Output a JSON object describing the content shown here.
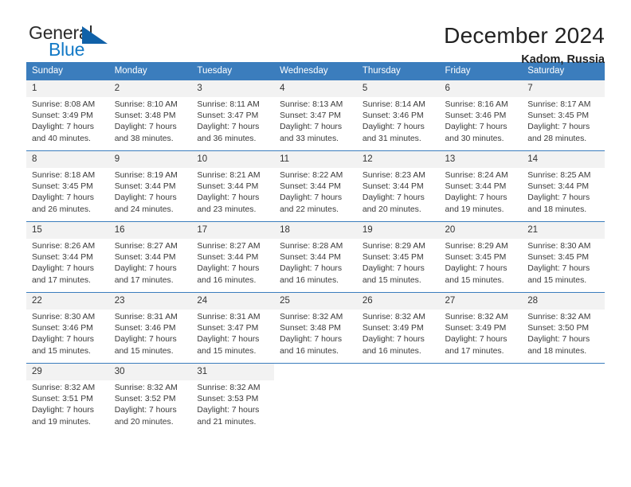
{
  "brand": {
    "name_part1": "General",
    "name_part2": "Blue",
    "logo_icon": "triangle-icon"
  },
  "header": {
    "title": "December 2024",
    "location": "Kadom, Russia"
  },
  "calendar": {
    "weekday_headers": [
      "Sunday",
      "Monday",
      "Tuesday",
      "Wednesday",
      "Thursday",
      "Friday",
      "Saturday"
    ],
    "accent_color": "#3b7dbd",
    "daynum_band_color": "#f2f2f2",
    "weeks": [
      [
        {
          "day": "1",
          "sunrise": "Sunrise: 8:08 AM",
          "sunset": "Sunset: 3:49 PM",
          "daylight_line1": "Daylight: 7 hours",
          "daylight_line2": "and 40 minutes."
        },
        {
          "day": "2",
          "sunrise": "Sunrise: 8:10 AM",
          "sunset": "Sunset: 3:48 PM",
          "daylight_line1": "Daylight: 7 hours",
          "daylight_line2": "and 38 minutes."
        },
        {
          "day": "3",
          "sunrise": "Sunrise: 8:11 AM",
          "sunset": "Sunset: 3:47 PM",
          "daylight_line1": "Daylight: 7 hours",
          "daylight_line2": "and 36 minutes."
        },
        {
          "day": "4",
          "sunrise": "Sunrise: 8:13 AM",
          "sunset": "Sunset: 3:47 PM",
          "daylight_line1": "Daylight: 7 hours",
          "daylight_line2": "and 33 minutes."
        },
        {
          "day": "5",
          "sunrise": "Sunrise: 8:14 AM",
          "sunset": "Sunset: 3:46 PM",
          "daylight_line1": "Daylight: 7 hours",
          "daylight_line2": "and 31 minutes."
        },
        {
          "day": "6",
          "sunrise": "Sunrise: 8:16 AM",
          "sunset": "Sunset: 3:46 PM",
          "daylight_line1": "Daylight: 7 hours",
          "daylight_line2": "and 30 minutes."
        },
        {
          "day": "7",
          "sunrise": "Sunrise: 8:17 AM",
          "sunset": "Sunset: 3:45 PM",
          "daylight_line1": "Daylight: 7 hours",
          "daylight_line2": "and 28 minutes."
        }
      ],
      [
        {
          "day": "8",
          "sunrise": "Sunrise: 8:18 AM",
          "sunset": "Sunset: 3:45 PM",
          "daylight_line1": "Daylight: 7 hours",
          "daylight_line2": "and 26 minutes."
        },
        {
          "day": "9",
          "sunrise": "Sunrise: 8:19 AM",
          "sunset": "Sunset: 3:44 PM",
          "daylight_line1": "Daylight: 7 hours",
          "daylight_line2": "and 24 minutes."
        },
        {
          "day": "10",
          "sunrise": "Sunrise: 8:21 AM",
          "sunset": "Sunset: 3:44 PM",
          "daylight_line1": "Daylight: 7 hours",
          "daylight_line2": "and 23 minutes."
        },
        {
          "day": "11",
          "sunrise": "Sunrise: 8:22 AM",
          "sunset": "Sunset: 3:44 PM",
          "daylight_line1": "Daylight: 7 hours",
          "daylight_line2": "and 22 minutes."
        },
        {
          "day": "12",
          "sunrise": "Sunrise: 8:23 AM",
          "sunset": "Sunset: 3:44 PM",
          "daylight_line1": "Daylight: 7 hours",
          "daylight_line2": "and 20 minutes."
        },
        {
          "day": "13",
          "sunrise": "Sunrise: 8:24 AM",
          "sunset": "Sunset: 3:44 PM",
          "daylight_line1": "Daylight: 7 hours",
          "daylight_line2": "and 19 minutes."
        },
        {
          "day": "14",
          "sunrise": "Sunrise: 8:25 AM",
          "sunset": "Sunset: 3:44 PM",
          "daylight_line1": "Daylight: 7 hours",
          "daylight_line2": "and 18 minutes."
        }
      ],
      [
        {
          "day": "15",
          "sunrise": "Sunrise: 8:26 AM",
          "sunset": "Sunset: 3:44 PM",
          "daylight_line1": "Daylight: 7 hours",
          "daylight_line2": "and 17 minutes."
        },
        {
          "day": "16",
          "sunrise": "Sunrise: 8:27 AM",
          "sunset": "Sunset: 3:44 PM",
          "daylight_line1": "Daylight: 7 hours",
          "daylight_line2": "and 17 minutes."
        },
        {
          "day": "17",
          "sunrise": "Sunrise: 8:27 AM",
          "sunset": "Sunset: 3:44 PM",
          "daylight_line1": "Daylight: 7 hours",
          "daylight_line2": "and 16 minutes."
        },
        {
          "day": "18",
          "sunrise": "Sunrise: 8:28 AM",
          "sunset": "Sunset: 3:44 PM",
          "daylight_line1": "Daylight: 7 hours",
          "daylight_line2": "and 16 minutes."
        },
        {
          "day": "19",
          "sunrise": "Sunrise: 8:29 AM",
          "sunset": "Sunset: 3:45 PM",
          "daylight_line1": "Daylight: 7 hours",
          "daylight_line2": "and 15 minutes."
        },
        {
          "day": "20",
          "sunrise": "Sunrise: 8:29 AM",
          "sunset": "Sunset: 3:45 PM",
          "daylight_line1": "Daylight: 7 hours",
          "daylight_line2": "and 15 minutes."
        },
        {
          "day": "21",
          "sunrise": "Sunrise: 8:30 AM",
          "sunset": "Sunset: 3:45 PM",
          "daylight_line1": "Daylight: 7 hours",
          "daylight_line2": "and 15 minutes."
        }
      ],
      [
        {
          "day": "22",
          "sunrise": "Sunrise: 8:30 AM",
          "sunset": "Sunset: 3:46 PM",
          "daylight_line1": "Daylight: 7 hours",
          "daylight_line2": "and 15 minutes."
        },
        {
          "day": "23",
          "sunrise": "Sunrise: 8:31 AM",
          "sunset": "Sunset: 3:46 PM",
          "daylight_line1": "Daylight: 7 hours",
          "daylight_line2": "and 15 minutes."
        },
        {
          "day": "24",
          "sunrise": "Sunrise: 8:31 AM",
          "sunset": "Sunset: 3:47 PM",
          "daylight_line1": "Daylight: 7 hours",
          "daylight_line2": "and 15 minutes."
        },
        {
          "day": "25",
          "sunrise": "Sunrise: 8:32 AM",
          "sunset": "Sunset: 3:48 PM",
          "daylight_line1": "Daylight: 7 hours",
          "daylight_line2": "and 16 minutes."
        },
        {
          "day": "26",
          "sunrise": "Sunrise: 8:32 AM",
          "sunset": "Sunset: 3:49 PM",
          "daylight_line1": "Daylight: 7 hours",
          "daylight_line2": "and 16 minutes."
        },
        {
          "day": "27",
          "sunrise": "Sunrise: 8:32 AM",
          "sunset": "Sunset: 3:49 PM",
          "daylight_line1": "Daylight: 7 hours",
          "daylight_line2": "and 17 minutes."
        },
        {
          "day": "28",
          "sunrise": "Sunrise: 8:32 AM",
          "sunset": "Sunset: 3:50 PM",
          "daylight_line1": "Daylight: 7 hours",
          "daylight_line2": "and 18 minutes."
        }
      ],
      [
        {
          "day": "29",
          "sunrise": "Sunrise: 8:32 AM",
          "sunset": "Sunset: 3:51 PM",
          "daylight_line1": "Daylight: 7 hours",
          "daylight_line2": "and 19 minutes."
        },
        {
          "day": "30",
          "sunrise": "Sunrise: 8:32 AM",
          "sunset": "Sunset: 3:52 PM",
          "daylight_line1": "Daylight: 7 hours",
          "daylight_line2": "and 20 minutes."
        },
        {
          "day": "31",
          "sunrise": "Sunrise: 8:32 AM",
          "sunset": "Sunset: 3:53 PM",
          "daylight_line1": "Daylight: 7 hours",
          "daylight_line2": "and 21 minutes."
        },
        {
          "day": "",
          "sunrise": "",
          "sunset": "",
          "daylight_line1": "",
          "daylight_line2": ""
        },
        {
          "day": "",
          "sunrise": "",
          "sunset": "",
          "daylight_line1": "",
          "daylight_line2": ""
        },
        {
          "day": "",
          "sunrise": "",
          "sunset": "",
          "daylight_line1": "",
          "daylight_line2": ""
        },
        {
          "day": "",
          "sunrise": "",
          "sunset": "",
          "daylight_line1": "",
          "daylight_line2": ""
        }
      ]
    ]
  }
}
